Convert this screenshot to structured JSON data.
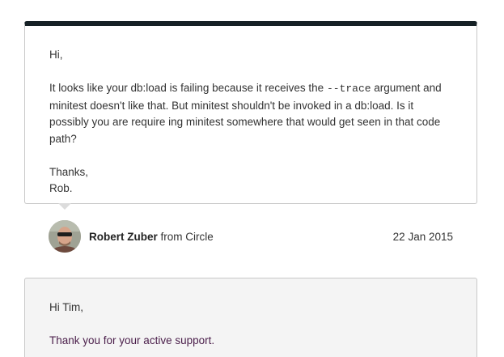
{
  "message": {
    "greeting": "Hi,",
    "para_before_code": "It looks like your db:load is failing because it receives the ",
    "code_arg": "--trace",
    "para_after_code": " argument and minitest doesn't like that. But minitest shouldn't be invoked in a db:load. Is it possibly you are require ing minitest somewhere that would get seen in that code path?",
    "signoff": "Thanks,",
    "signature": "Rob."
  },
  "author": {
    "name": "Robert Zuber",
    "from_text": " from Circle",
    "date": "22 Jan 2015",
    "avatar_icon": "user-avatar"
  },
  "reply": {
    "greeting": "Hi Tim,",
    "line1": "Thank you for your active support."
  },
  "colors": {
    "card_top_border": "#162126",
    "reply_text_accent": "#4a1e4a",
    "reply_background": "#f4f4f4"
  }
}
